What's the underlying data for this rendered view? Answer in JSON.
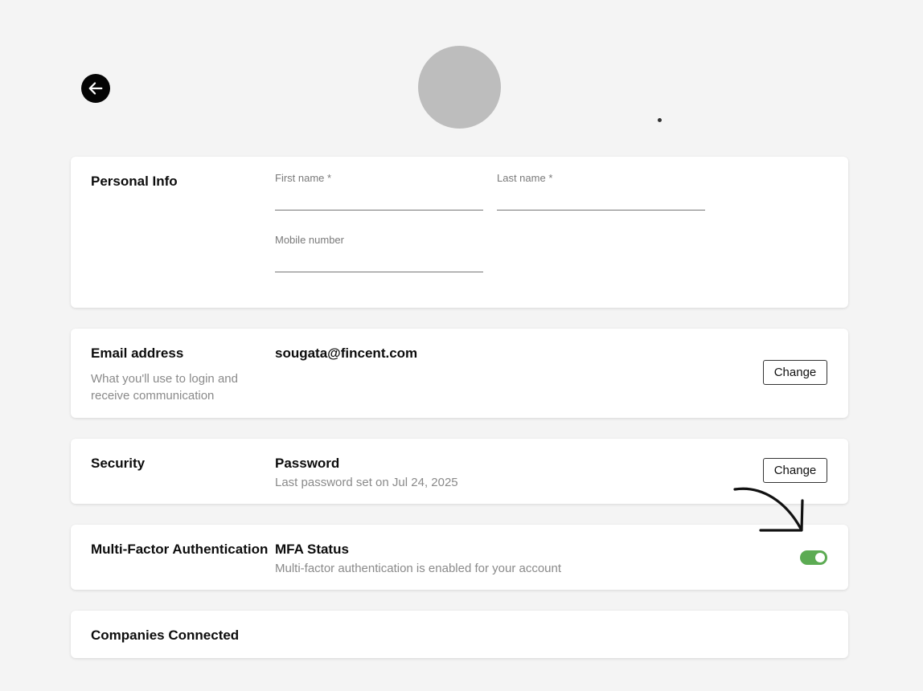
{
  "avatar": {
    "label": ""
  },
  "personal_info": {
    "title": "Personal Info",
    "first_name": {
      "label": "First name *",
      "value": ""
    },
    "last_name": {
      "label": "Last name *",
      "value": ""
    },
    "mobile": {
      "label": "Mobile number",
      "value": ""
    }
  },
  "email": {
    "title": "Email address",
    "description": "What you'll use to login and receive communication",
    "value": "sougata@fincent.com",
    "change_label": "Change"
  },
  "security": {
    "title": "Security",
    "password_title": "Password",
    "password_sub": "Last password set on Jul 24, 2025",
    "change_label": "Change"
  },
  "mfa": {
    "title": "Multi-Factor Authentication",
    "status_title": "MFA Status",
    "status_sub": "Multi-factor authentication is enabled for your account",
    "enabled": true,
    "toggle_color": "#5cab53"
  },
  "companies": {
    "title": "Companies Connected"
  },
  "icons": {
    "back": "arrow-left-icon"
  }
}
